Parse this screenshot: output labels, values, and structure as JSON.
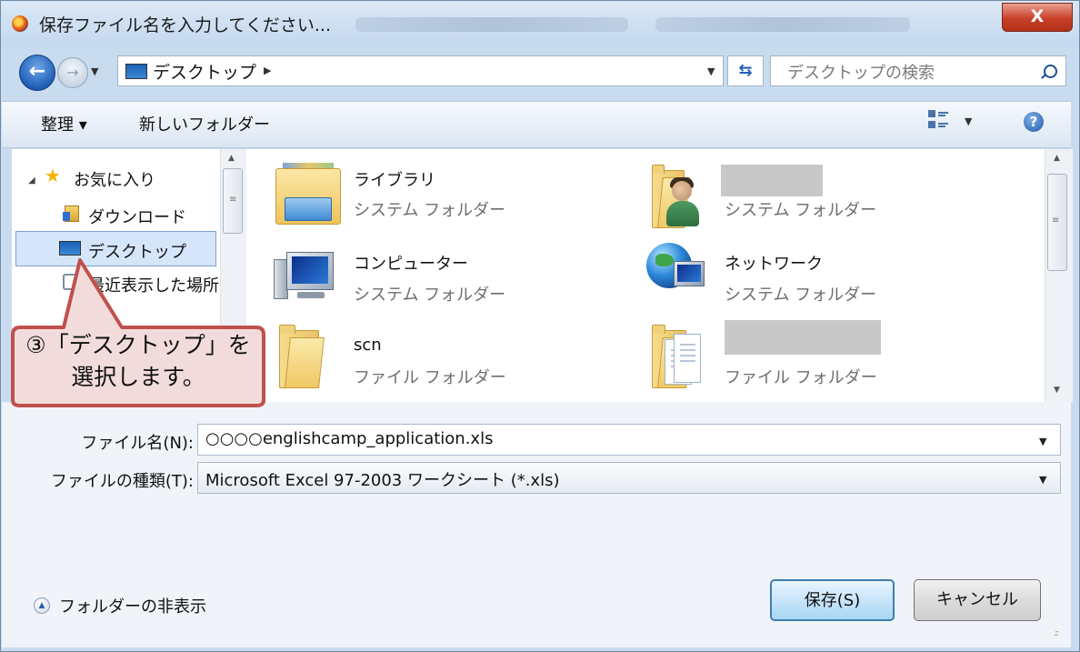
{
  "window": {
    "title": "保存ファイル名を入力してください...",
    "close_label": "X"
  },
  "navbar": {
    "address": "デスクトップ",
    "search_placeholder": "デスクトップの検索"
  },
  "toolbar": {
    "organize": "整理 ▾",
    "new_folder": "新しいフォルダー"
  },
  "sidebar": {
    "items": [
      {
        "label": "お気に入り",
        "icon": "star-icon"
      },
      {
        "label": "ダウンロード",
        "icon": "download-folder-icon"
      },
      {
        "label": "デスクトップ",
        "icon": "desktop-icon",
        "selected": true
      },
      {
        "label": "最近表示した場所",
        "icon": "recent-places-icon"
      }
    ]
  },
  "content": {
    "items": [
      {
        "name": "ライブラリ",
        "type": "システム フォルダー",
        "icon": "library-icon"
      },
      {
        "name": "",
        "type": "システム フォルダー",
        "icon": "user-folder-icon"
      },
      {
        "name": "コンピューター",
        "type": "システム フォルダー",
        "icon": "computer-icon"
      },
      {
        "name": "ネットワーク",
        "type": "システム フォルダー",
        "icon": "network-icon"
      },
      {
        "name": "scn",
        "type": "ファイル フォルダー",
        "icon": "folder-icon"
      },
      {
        "name": "",
        "type": "ファイル フォルダー",
        "icon": "documents-folder-icon"
      }
    ]
  },
  "form": {
    "filename_label": "ファイル名(N):",
    "filename_value": "○○○○englishcamp_application.xls",
    "filetype_label": "ファイルの種類(T):",
    "filetype_value": "Microsoft Excel 97-2003 ワークシート (*.xls)"
  },
  "buttons": {
    "save": "保存(S)",
    "cancel": "キャンセル",
    "hide_folders": "フォルダーの非表示"
  },
  "callout": {
    "line1": "③「デスクトップ」を",
    "line2": "選択します。"
  },
  "colors": {
    "callout_fill": "#f2dcdb",
    "callout_border": "#c0504d",
    "selection": "#d5e6fb"
  }
}
